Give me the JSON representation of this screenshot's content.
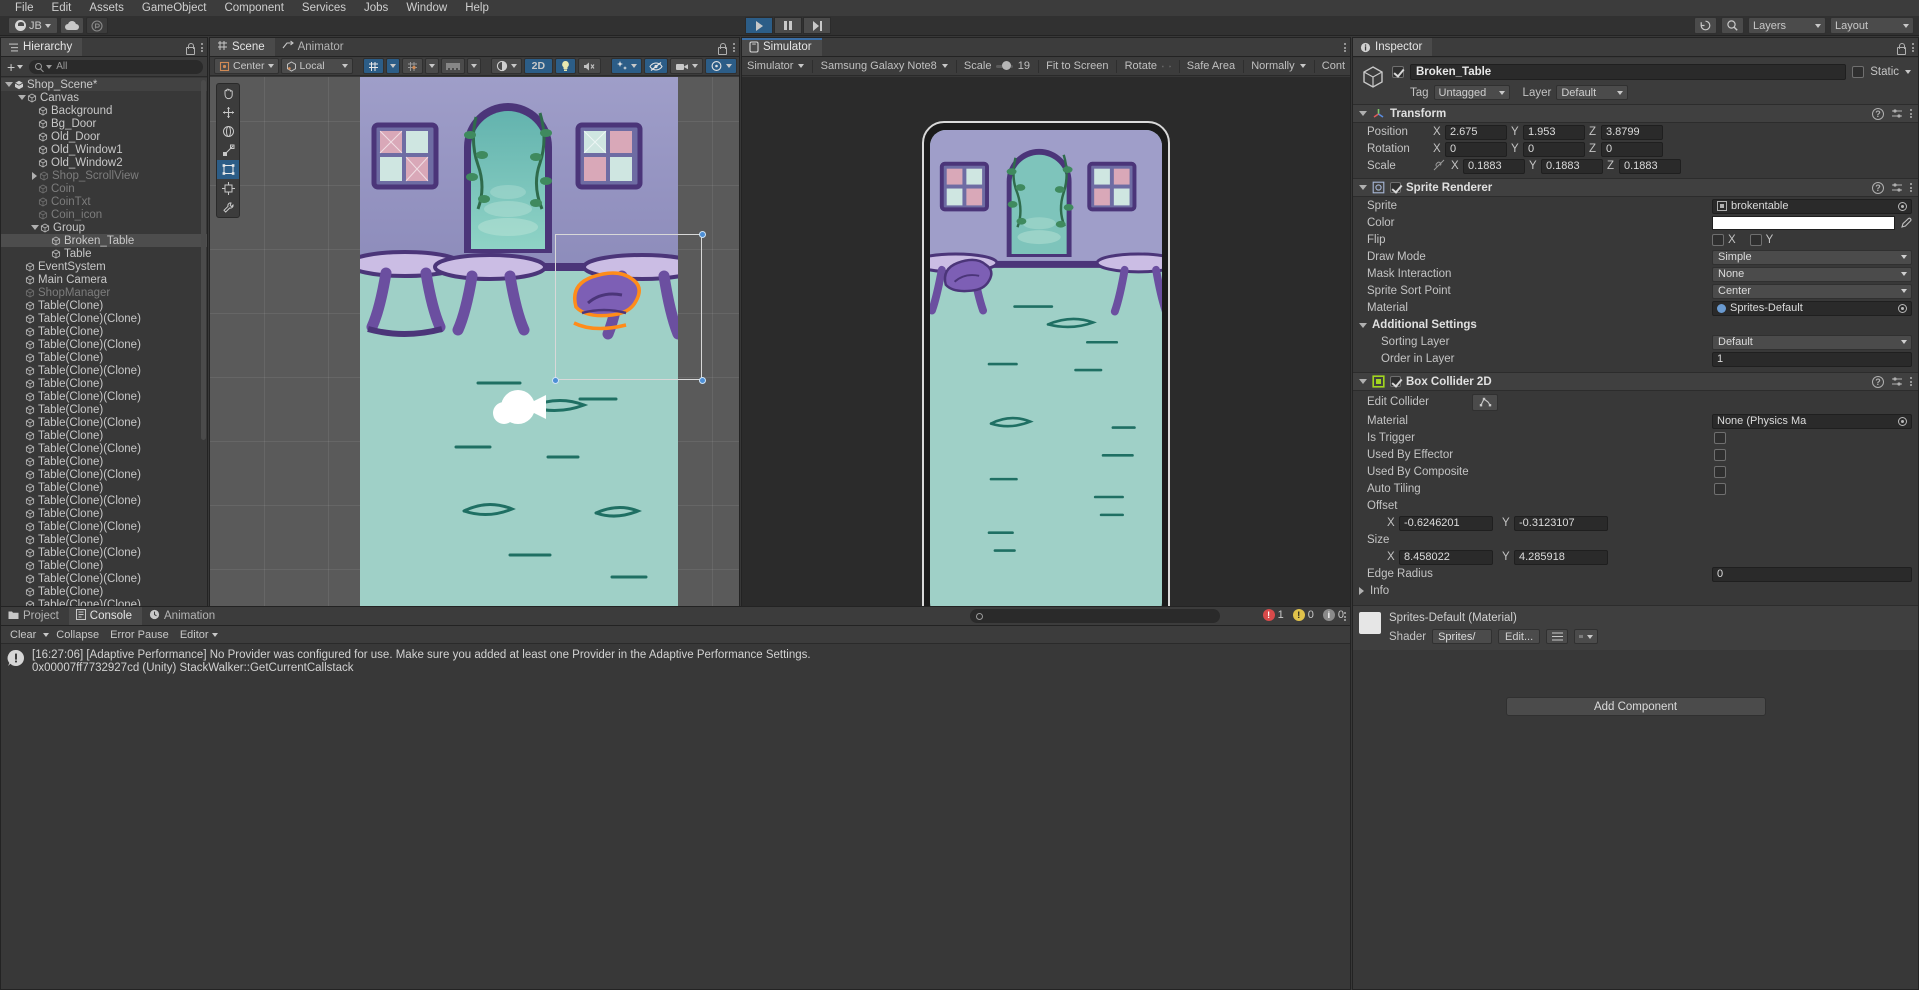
{
  "menubar": {
    "items": [
      "File",
      "Edit",
      "Assets",
      "GameObject",
      "Component",
      "Services",
      "Jobs",
      "Window",
      "Help"
    ]
  },
  "toolbar": {
    "account": "JB",
    "cloud_icon": "cloud-icon",
    "collab_icon": "collab-icon",
    "play_icon": "play-icon",
    "pause_icon": "pause-icon",
    "step_icon": "step-icon",
    "undo_icon": "undo-history-icon",
    "search_icon": "search-icon",
    "layers_label": "Layers",
    "layout_label": "Layout"
  },
  "hierarchy": {
    "tab_label": "Hierarchy",
    "tab_icon": "hierarchy-icon",
    "add_label": "+",
    "search_placeholder": "All",
    "items": [
      {
        "label": "Shop_Scene*",
        "depth": 0,
        "expanded": true,
        "dim": false,
        "selected": false,
        "scene": true
      },
      {
        "label": "Canvas",
        "depth": 1,
        "expanded": true,
        "dim": false,
        "selected": false
      },
      {
        "label": "Background",
        "depth": 2,
        "dim": false
      },
      {
        "label": "Bg_Door",
        "depth": 2,
        "dim": false
      },
      {
        "label": "Old_Door",
        "depth": 2,
        "dim": false
      },
      {
        "label": "Old_Window1",
        "depth": 2,
        "dim": false
      },
      {
        "label": "Old_Window2",
        "depth": 2,
        "dim": false
      },
      {
        "label": "Shop_ScrollView",
        "depth": 2,
        "collapsed": true,
        "dim": true
      },
      {
        "label": "Coin",
        "depth": 2,
        "dim": true
      },
      {
        "label": "CoinTxt",
        "depth": 2,
        "dim": true
      },
      {
        "label": "Coin_icon",
        "depth": 2,
        "dim": true
      },
      {
        "label": "Group",
        "depth": 2,
        "expanded": true,
        "dim": false
      },
      {
        "label": "Broken_Table",
        "depth": 3,
        "dim": false,
        "selected": true
      },
      {
        "label": "Table",
        "depth": 3,
        "dim": false
      },
      {
        "label": "EventSystem",
        "depth": 1,
        "dim": false
      },
      {
        "label": "Main Camera",
        "depth": 1,
        "dim": false
      },
      {
        "label": "ShopManager",
        "depth": 1,
        "dim": true
      },
      {
        "label": "Table(Clone)",
        "depth": 1,
        "dim": false
      },
      {
        "label": "Table(Clone)(Clone)",
        "depth": 1,
        "dim": false
      },
      {
        "label": "Table(Clone)",
        "depth": 1,
        "dim": false
      },
      {
        "label": "Table(Clone)(Clone)",
        "depth": 1,
        "dim": false
      },
      {
        "label": "Table(Clone)",
        "depth": 1,
        "dim": false
      },
      {
        "label": "Table(Clone)(Clone)",
        "depth": 1,
        "dim": false
      },
      {
        "label": "Table(Clone)",
        "depth": 1,
        "dim": false
      },
      {
        "label": "Table(Clone)(Clone)",
        "depth": 1,
        "dim": false
      },
      {
        "label": "Table(Clone)",
        "depth": 1,
        "dim": false
      },
      {
        "label": "Table(Clone)(Clone)",
        "depth": 1,
        "dim": false
      },
      {
        "label": "Table(Clone)",
        "depth": 1,
        "dim": false
      },
      {
        "label": "Table(Clone)(Clone)",
        "depth": 1,
        "dim": false
      },
      {
        "label": "Table(Clone)",
        "depth": 1,
        "dim": false
      },
      {
        "label": "Table(Clone)(Clone)",
        "depth": 1,
        "dim": false
      },
      {
        "label": "Table(Clone)",
        "depth": 1,
        "dim": false
      },
      {
        "label": "Table(Clone)(Clone)",
        "depth": 1,
        "dim": false
      },
      {
        "label": "Table(Clone)",
        "depth": 1,
        "dim": false
      },
      {
        "label": "Table(Clone)(Clone)",
        "depth": 1,
        "dim": false
      },
      {
        "label": "Table(Clone)",
        "depth": 1,
        "dim": false
      },
      {
        "label": "Table(Clone)(Clone)",
        "depth": 1,
        "dim": false
      },
      {
        "label": "Table(Clone)",
        "depth": 1,
        "dim": false
      },
      {
        "label": "Table(Clone)(Clone)",
        "depth": 1,
        "dim": false
      },
      {
        "label": "Table(Clone)",
        "depth": 1,
        "dim": false
      },
      {
        "label": "Table(Clone)(Clone)",
        "depth": 1,
        "dim": false
      }
    ]
  },
  "scene": {
    "tabs": [
      {
        "label": "Scene",
        "icon": "grid-hash-icon",
        "selected": true
      },
      {
        "label": "Animator",
        "icon": "animator-icon",
        "selected": false
      }
    ],
    "toolbar": {
      "pivot_mode": "Center",
      "pivot_rotation": "Local",
      "grid_axis_icon": "grid-y-icon",
      "snap_icon": "snap-increment-icon",
      "ruler_icon": "grid-visibility-icon",
      "shading_icon": "shading-mode-icon",
      "mode_2d": "2D",
      "light_icon": "lighting-icon",
      "audio_icon": "audio-mute-icon",
      "fx_icon": "effects-icon",
      "hidden_icon": "hidden-objects-icon",
      "camera_icon": "scene-camera-icon",
      "gizmos_icon": "gizmos-icon"
    },
    "tools": [
      "hand-tool",
      "move-tool",
      "rotate-tool",
      "scale-tool",
      "rect-tool",
      "transform-tool",
      "custom-tool"
    ],
    "selected_tool_index": 4
  },
  "simulator": {
    "tab_label": "Simulator",
    "tab_icon": "device-icon",
    "view_mode": "Simulator",
    "device": "Samsung Galaxy Note8",
    "scale_label": "Scale",
    "scale_value": "19",
    "fit_label": "Fit to Screen",
    "rotate_label": "Rotate",
    "rotate_ccw_icon": "rotate-ccw-icon",
    "rotate_cw_icon": "rotate-cw-icon",
    "safe_area_label": "Safe Area",
    "resolution_label": "Normally",
    "control_label": "Cont"
  },
  "console": {
    "tabs": [
      {
        "label": "Project",
        "icon": "folder-icon",
        "selected": false
      },
      {
        "label": "Console",
        "icon": "console-icon",
        "selected": true
      },
      {
        "label": "Animation",
        "icon": "animation-clock-icon",
        "selected": false
      }
    ],
    "toolbar": {
      "clear_label": "Clear",
      "collapse_label": "Collapse",
      "error_pause_label": "Error Pause",
      "editor_label": "Editor",
      "search_placeholder": ""
    },
    "counts": {
      "error": "1",
      "warning": "0",
      "info": "0"
    },
    "entries": [
      {
        "icon": "error-icon",
        "line1": "[16:27:06] [Adaptive Performance] No Provider was configured for use. Make sure you added at least one Provider in the Adaptive Performance Settings.",
        "line2": "0x00007ff7732927cd (Unity) StackWalker::GetCurrentCallstack"
      }
    ]
  },
  "inspector": {
    "tab_label": "Inspector",
    "tab_icon": "info-icon",
    "object_name": "Broken_Table",
    "enabled": true,
    "static_label": "Static",
    "tag_label": "Tag",
    "tag_value": "Untagged",
    "layer_label": "Layer",
    "layer_value": "Default",
    "transform": {
      "title": "Transform",
      "icon": "transform-axis-icon",
      "rows": [
        {
          "label": "Position",
          "x": "2.675",
          "y": "1.953",
          "z": "3.8799"
        },
        {
          "label": "Rotation",
          "x": "0",
          "y": "0",
          "z": "0"
        },
        {
          "label": "Scale",
          "x": "0.1883",
          "y": "0.1883",
          "z": "0.1883",
          "link_icon": "constrain-proportions-off-icon"
        }
      ]
    },
    "sprite_renderer": {
      "title": "Sprite Renderer",
      "icon": "sprite-renderer-icon",
      "enabled": true,
      "sprite_label": "Sprite",
      "sprite_value": "brokentable",
      "color_label": "Color",
      "color_value": "#FFFFFF",
      "eyedropper_icon": "eyedropper-icon",
      "flip_label": "Flip",
      "flip_x_label": "X",
      "flip_y_label": "Y",
      "flip_x": false,
      "flip_y": false,
      "draw_mode_label": "Draw Mode",
      "draw_mode_value": "Simple",
      "mask_interaction_label": "Mask Interaction",
      "mask_interaction_value": "None",
      "sort_point_label": "Sprite Sort Point",
      "sort_point_value": "Center",
      "material_label": "Material",
      "material_value": "Sprites-Default",
      "additional_settings_label": "Additional Settings",
      "sorting_layer_label": "Sorting Layer",
      "sorting_layer_value": "Default",
      "order_in_layer_label": "Order in Layer",
      "order_in_layer_value": "1"
    },
    "box_collider": {
      "title": "Box Collider 2D",
      "icon": "box-collider-2d-icon",
      "enabled": true,
      "edit_collider_label": "Edit Collider",
      "edit_collider_icon": "edit-collider-icon",
      "material_label": "Material",
      "material_value": "None (Physics Ma",
      "is_trigger_label": "Is Trigger",
      "is_trigger": false,
      "used_by_effector_label": "Used By Effector",
      "used_by_effector": false,
      "used_by_composite_label": "Used By Composite",
      "used_by_composite": false,
      "auto_tiling_label": "Auto Tiling",
      "auto_tiling": false,
      "offset_label": "Offset",
      "offset_x": "-0.6246201",
      "offset_y": "-0.3123107",
      "size_label": "Size",
      "size_x": "8.458022",
      "size_y": "4.285918",
      "edge_radius_label": "Edge Radius",
      "edge_radius_value": "0",
      "info_label": "Info"
    },
    "material_preview": {
      "title": "Sprites-Default (Material)",
      "shader_label": "Shader",
      "shader_value": "Sprites/",
      "edit_label": "Edit...",
      "list_icon": "list-icon",
      "menu_icon": "menu-icon"
    },
    "add_component_label": "Add Component"
  },
  "colors": {
    "accent_blue": "#3b6ea5",
    "panel_bg": "#383838",
    "header_bg": "#3c3c3c",
    "collider_green": "#a2d61e",
    "selection_orange": "#ff8c1a"
  }
}
